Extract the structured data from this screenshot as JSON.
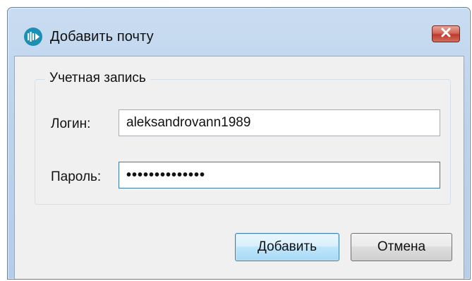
{
  "window": {
    "title": "Добавить почту"
  },
  "icons": {
    "app": "app-logo-icon",
    "close": "close-icon"
  },
  "group": {
    "legend": "Учетная запись",
    "login_label": "Логин:",
    "login_value": "aleksandrovann1989",
    "password_label": "Пароль:",
    "password_mask": "••••••••••••••"
  },
  "buttons": {
    "add": "Добавить",
    "cancel": "Отмена"
  },
  "colors": {
    "close_red": "#c0392b",
    "focus_blue": "#3d7bad",
    "logo_teal": "#1b8fb4"
  }
}
